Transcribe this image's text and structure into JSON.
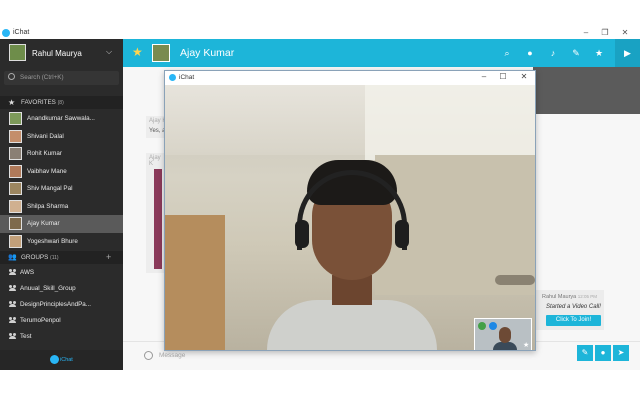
{
  "os": {
    "title": "iChat",
    "controls": [
      "–",
      "❐",
      "✕"
    ]
  },
  "user": {
    "name": "Rahul Maurya"
  },
  "search": {
    "placeholder": "Search (Ctrl+K)"
  },
  "favorites": {
    "label": "FAVORITES",
    "count": "(8)",
    "items": [
      "Anandkumar Sawwala...",
      "Shivani Dalal",
      "Rohit Kumar",
      "Vaibhav Mane",
      "Shiv Mangal Pal",
      "Shilpa Sharma",
      "Ajay Kumar",
      "Yogeshwari Bhure"
    ],
    "active_index": 6
  },
  "groups": {
    "label": "GROUPS",
    "count": "(11)",
    "items": [
      "AWS",
      "Anuual_Skill_Group",
      "DesignPrinciplesAndPa...",
      "TerumoPenpol",
      "Test"
    ]
  },
  "footer": {
    "brand": "iChat"
  },
  "chat": {
    "title": "Ajay Kumar",
    "bubble_name": "Ajay K",
    "bubble_text": "Yes, a",
    "bubble2_name": "Ajay K",
    "right_bubble": {
      "sender": "Rahul Maurya",
      "time": "12:05 PM",
      "message": "Started a Video Call!",
      "button": "Click To Join!"
    },
    "composer_placeholder": "Message"
  },
  "video_window": {
    "title": "iChat",
    "controls": [
      "–",
      "☐",
      "✕"
    ]
  },
  "colors": {
    "accent": "#1db5d9",
    "sidebar": "#2b2b2b",
    "star": "#ffd54f"
  }
}
